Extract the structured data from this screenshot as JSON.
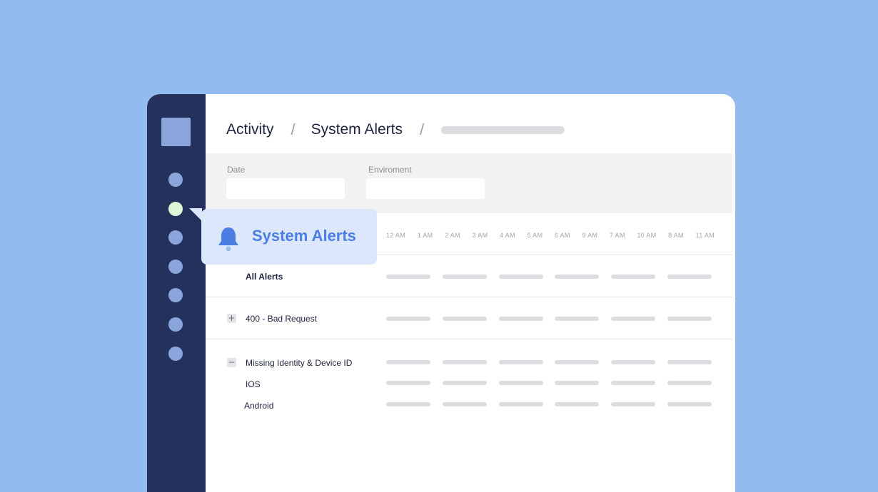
{
  "breadcrumb": [
    "Activity",
    "System Alerts"
  ],
  "filters": {
    "date_label": "Date",
    "env_label": "Enviroment"
  },
  "hours": [
    "12 AM",
    "1 AM",
    "2 AM",
    "3 AM",
    "4 AM",
    "5 AM",
    "6 AM",
    "9 AM",
    "7 AM",
    "10 AM",
    "8 AM",
    "11 AM"
  ],
  "rows": {
    "all_alerts": "All Alerts",
    "bad_request": "400 - Bad Request",
    "missing_identity": "Missing Identity & Device ID",
    "ios": "IOS",
    "android": "Android"
  },
  "toggles": {
    "expand": "+",
    "collapse": "−"
  },
  "tooltip": {
    "text": "System Alerts",
    "icon": "bell-icon"
  },
  "colors": {
    "background": "#92bbef",
    "sidebar": "#23315c",
    "nav_dot": "#8aa5dc",
    "nav_dot_active": "#dff5d8",
    "accent": "#4a7ee2"
  }
}
